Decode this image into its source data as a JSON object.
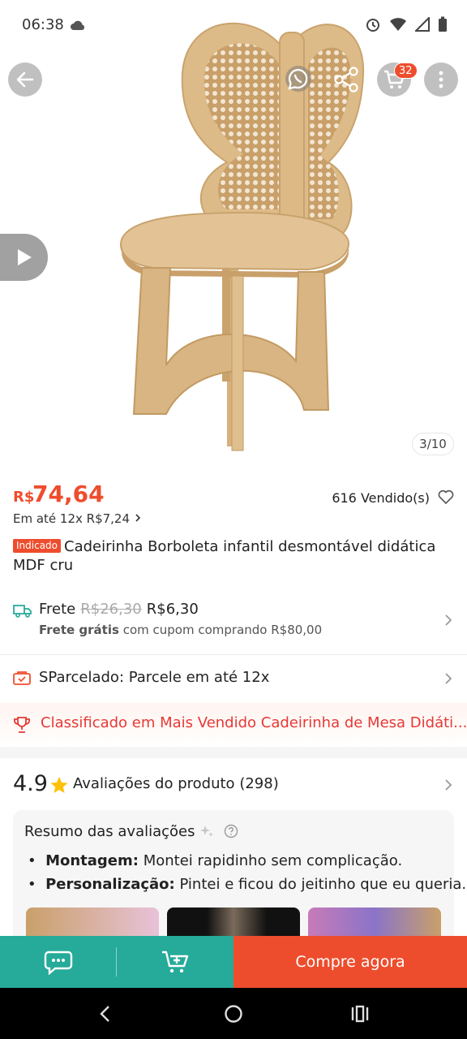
{
  "status_bar": {
    "time": "06:38"
  },
  "hero": {
    "cart_count": "32",
    "page_counter": "3/10",
    "icons": [
      "back-arrow-icon",
      "whatsapp-icon",
      "share-icon",
      "cart-icon",
      "more-vertical-icon",
      "play-icon"
    ]
  },
  "price": {
    "currency": "R$",
    "value": "74,64",
    "sold": "616 Vendido(s)",
    "installment": "Em até 12x R$7,24"
  },
  "product": {
    "tag": "Indicado",
    "title": "Cadeirinha Borboleta infantil desmontável didática MDF cru"
  },
  "shipping": {
    "label": "Frete",
    "old_price": "R$26,30",
    "price": "R$6,30",
    "free_bold": "Frete grátis",
    "free_rest": "com cupom comprando R$80,00"
  },
  "parcel": {
    "text": "SParcelado: Parcele em até 12x"
  },
  "ranked": {
    "text": "Classificado em Mais Vendido Cadeirinha de Mesa Didáti..."
  },
  "rating": {
    "value": "4.9",
    "label": "Avaliações do produto",
    "count": "(298)"
  },
  "summary": {
    "title": "Resumo das avaliações",
    "items": [
      {
        "key": "Montagem:",
        "text": "Montei rapidinho sem complicação."
      },
      {
        "key": "Personalização:",
        "text": "Pintei e ficou do jeitinho que eu queria."
      }
    ]
  },
  "bottom": {
    "buy_label": "Compre agora"
  },
  "colors": {
    "accent": "#ee4d2d",
    "teal": "#26aa99",
    "wood": "#d9b88a"
  }
}
